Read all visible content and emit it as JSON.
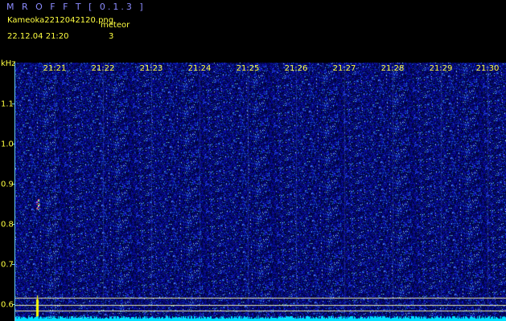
{
  "header": {
    "app_title": "M R O F F T  [ 0.1.3 ]",
    "filename": "Kameoka2212042120.png",
    "meteor_label": "meteor",
    "datetime": "22.12.04  21:20",
    "meteor_count": "3"
  },
  "axis": {
    "unit": "kHz",
    "time_labels": [
      "21:21",
      "21:22",
      "21:23",
      "21:24",
      "21:25",
      "21:26",
      "21:27",
      "21:28",
      "21:29",
      "21:30"
    ],
    "freq_labels": [
      "1.1",
      "1.0",
      "0.9",
      "0.8",
      "0.7",
      "0.6"
    ]
  },
  "colors": {
    "background": "#000000",
    "plot_noise": "#000a50",
    "text": "#ffff40",
    "title": "#8c8cff",
    "axis": "#6ad0ff",
    "reference_lines": "#e8e8b0",
    "signal_baseline": "#00e0ff",
    "meteor_streak": "#ffff00"
  }
}
